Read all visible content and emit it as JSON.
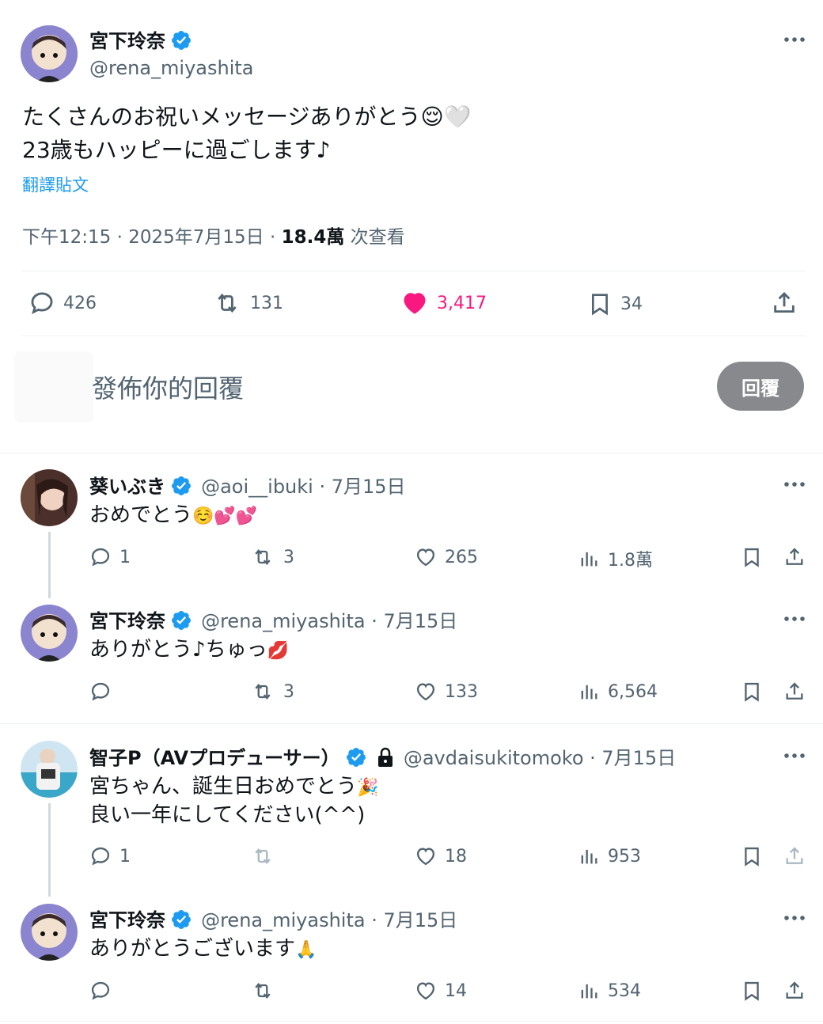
{
  "main_tweet": {
    "name": "宮下玲奈",
    "handle": "@rena_miyashita",
    "text_line1": "たくさんのお祝いメッセージありがとう",
    "text_line1_emoji": "😌🤍",
    "text_line2": "23歳もハッピーに過ごします♪",
    "translate": "翻譯貼文",
    "time": "下午12:15 · 2025年7月15日 · ",
    "views": "18.4萬",
    "views_label": " 次查看",
    "stats": {
      "replies": "426",
      "retweets": "131",
      "likes": "3,417",
      "bookmarks": "34"
    },
    "like_color": "#f91880"
  },
  "reply_box": {
    "placeholder": "發佈你的回覆",
    "button": "回覆"
  },
  "replies": [
    {
      "name": "葵いぶき",
      "handle": "@aoi__ibuki · 7月15日",
      "text": "おめでとう",
      "emoji": "☺️💕💕",
      "stats": {
        "replies": "1",
        "retweets": "3",
        "likes": "265",
        "views": "1.8萬"
      }
    },
    {
      "name": "宮下玲奈",
      "handle": "@rena_miyashita · 7月15日",
      "text": "ありがとう♪ちゅっ",
      "emoji": "💋",
      "stats": {
        "replies": "",
        "retweets": "3",
        "likes": "133",
        "views": "6,564"
      }
    },
    {
      "name": "智子P（AVプロデューサー）",
      "handle": "@avdaisukitomoko · 7月15日",
      "text": "宮ちゃん、誕生日おめでとう",
      "emoji": "🎉",
      "text2": "良い一年にしてください(^^)",
      "stats": {
        "replies": "1",
        "retweets": "",
        "likes": "18",
        "views": "953"
      }
    },
    {
      "name": "宮下玲奈",
      "handle": "@rena_miyashita · 7月15日",
      "text": "ありがとうございます",
      "emoji": "🙏",
      "stats": {
        "replies": "",
        "retweets": "",
        "likes": "14",
        "views": "534"
      }
    }
  ],
  "colors": {
    "verified": "#1d9bf0",
    "link": "#1d9bf0",
    "reply_button": "#87898c"
  }
}
